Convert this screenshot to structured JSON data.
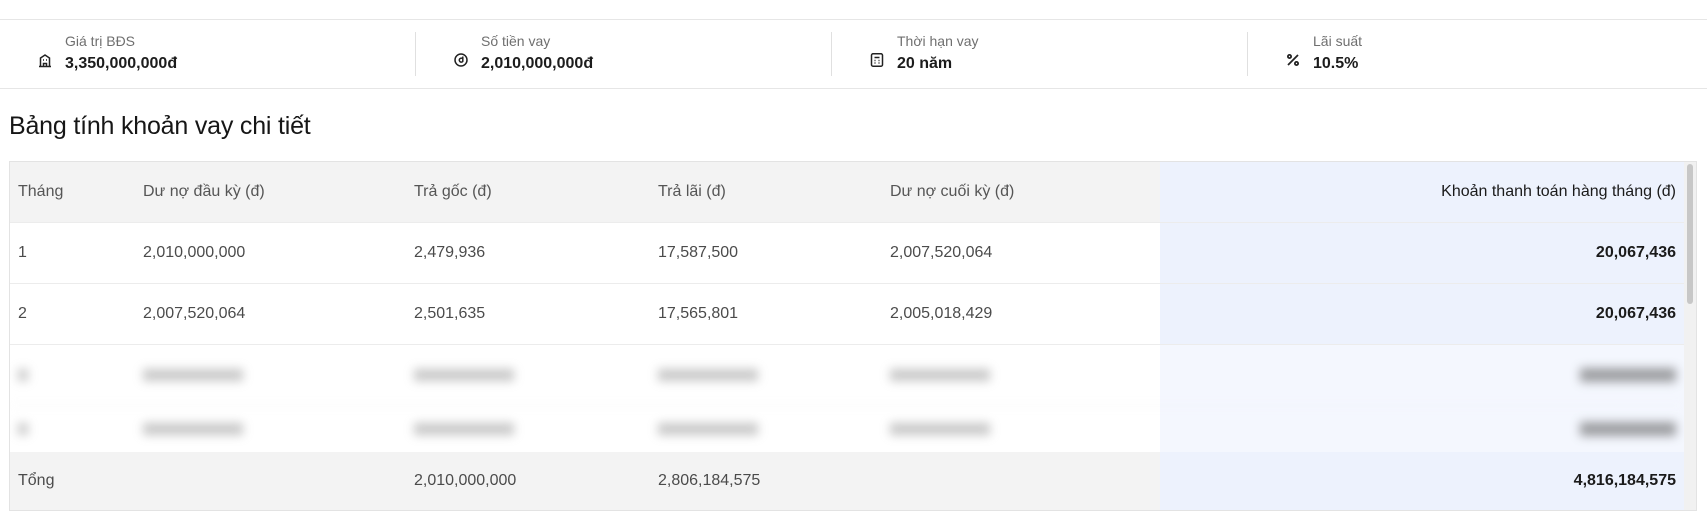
{
  "summary": {
    "items": [
      {
        "icon": "building-icon",
        "label": "Giá trị BĐS",
        "value": "3,350,000,000đ"
      },
      {
        "icon": "money-coin-icon",
        "label": "Số tiền vay",
        "value": "2,010,000,000đ"
      },
      {
        "icon": "calculator-icon",
        "label": "Thời hạn vay",
        "value": "20 năm"
      },
      {
        "icon": "percent-icon",
        "label": "Lãi suất",
        "value": "10.5%"
      }
    ]
  },
  "section_title": "Bảng tính khoản vay chi tiết",
  "table": {
    "headers": [
      "Tháng",
      "Dư nợ đầu kỳ (đ)",
      "Trả gốc (đ)",
      "Trả lãi (đ)",
      "Dư nợ cuối kỳ (đ)",
      "Khoản thanh toán hàng tháng (đ)"
    ],
    "rows": [
      [
        "1",
        "2,010,000,000",
        "2,479,936",
        "17,587,500",
        "2,007,520,064",
        "20,067,436"
      ],
      [
        "2",
        "2,007,520,064",
        "2,501,635",
        "17,565,801",
        "2,005,018,429",
        "20,067,436"
      ]
    ],
    "total": {
      "label": "Tổng",
      "principal": "2,010,000,000",
      "interest": "2,806,184,575",
      "payment": "4,816,184,575"
    }
  },
  "colors": {
    "highlight_column": "#edf2fd",
    "header_bg": "#f3f3f3"
  }
}
